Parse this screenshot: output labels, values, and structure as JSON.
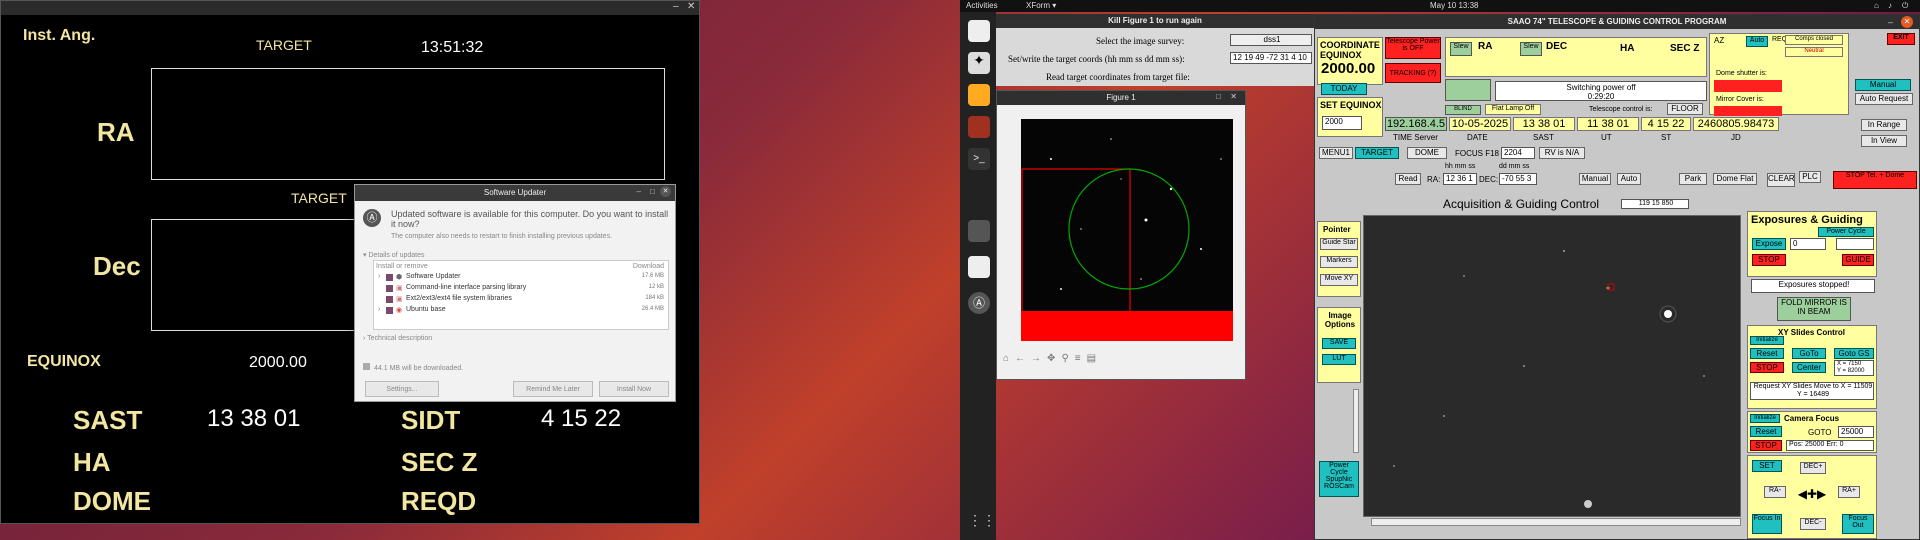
{
  "topbar": {
    "activities": "Activities",
    "app": "XForm ▾",
    "clock": "May 10  13:38"
  },
  "left": {
    "inst_ang": "Inst. Ang.",
    "target1": "TARGET",
    "time": "13:51:32",
    "ra": "RA",
    "target2": "TARGET",
    "dec": "Dec",
    "equinox_label": "EQUINOX",
    "equinox_val": "2000.00",
    "sast_label": "SAST",
    "sast_val": "13 38 01",
    "sidt_label": "SIDT",
    "sidt_val": "4 15 22",
    "ha_label": "HA",
    "secz_label": "SEC Z",
    "dome_label": "DOME",
    "reqd_label": "REQD"
  },
  "updater": {
    "title": "Software Updater",
    "headline": "Updated software is available for this computer. Do you want to install it now?",
    "sub": "The computer also needs to restart to finish installing previous updates.",
    "details": "Details of updates",
    "col_install": "Install or remove",
    "col_download": "Download",
    "items": [
      {
        "name": "Software Updater",
        "size": "17.6 MB"
      },
      {
        "name": "Command-line interface parsing library",
        "size": "12 kB"
      },
      {
        "name": "Ext2/ext3/ext4 file system libraries",
        "size": "184 kB"
      },
      {
        "name": "Ubuntu base",
        "size": "26.4 MB"
      }
    ],
    "tech": "Technical description",
    "total": "44.1 MB will be downloaded.",
    "settings": "Settings...",
    "remind": "Remind Me Later",
    "install": "Install Now"
  },
  "kill": {
    "title": "Kill Figure 1 to run again",
    "q1": "Select the image survey:",
    "v1": "dss1",
    "q2": "Set/write the target coords (hh mm ss dd mm ss):",
    "v2": "12 19 49 -72 31 4 10",
    "q3": "Read target coordinates from target file:"
  },
  "fig1": {
    "title": "Figure 1"
  },
  "saao": {
    "title": "SAAO 74\" TELESCOPE & GUIDING CONTROL PROGRAM",
    "coord_equinox": "COORDINATE EQUINOX",
    "equinox": "2000.00",
    "today": "TODAY",
    "set_equinox": "SET EQUINOX",
    "equinox_input": "2000",
    "tel_power": "Telescope Power is OFF",
    "tracking": "TRACKING (?)",
    "ra_lbl": "RA",
    "dec_lbl": "DEC",
    "ha_lbl": "HA",
    "secz_lbl": "SEC Z",
    "slew": "Slew",
    "status_line1": "Switching power off",
    "status_line2": "0:29:20",
    "blind": "BLIND",
    "flat_lamp": "Flat Lamp Off",
    "tel_control": "Telescope control is:",
    "floor": "FLOOR",
    "ip": "192.168.4.5",
    "date": "10-05-2025",
    "sast": "13 38 01",
    "ut": "11 38 01",
    "st": "4 15 22",
    "jd": "2460805.98473",
    "time_server": "TIME Server",
    "date_lbl": "DATE",
    "sast_lbl": "SAST",
    "ut_lbl": "UT",
    "st_lbl": "ST",
    "jd_lbl": "JD",
    "az": "AZ",
    "auto": "Auto",
    "reqd": "REQD",
    "exit": "EXIT",
    "comps": "Comps closed",
    "neutral": "Neutral",
    "dome_shutter": "Dome shutter is:",
    "mirror_cover": "Mirror Cover is:",
    "manual": "Manual",
    "auto_request": "Auto Request",
    "in_range": "In Range",
    "in_view": "In View",
    "menu1": "MENU1",
    "target": "TARGET",
    "dome": "DOME",
    "focus_lbl": "FOCUS F18",
    "focus_val": "2204",
    "rv": "RV is N/A",
    "hms": "hh  mm  ss",
    "dms": "dd  mm  ss",
    "read": "Read",
    "ra_in": "12 36 1",
    "dec_in": "-70 55 3",
    "park": "Park",
    "dome_flat": "Dome Flat",
    "clear": "CLEAR",
    "plc": "PLC",
    "manual2": "Manual",
    "auto2": "Auto",
    "stop_tel": "STOP Tel. + Dome",
    "acq_title": "Acquisition & Guiding Control",
    "acq_coord": "119 15 850",
    "pointer": "Pointer",
    "guide_star": "Guide Star",
    "markers": "Markers",
    "move_xy": "Move XY",
    "image_options": "Image Options",
    "save": "SAVE",
    "lut": "LUT",
    "power_cycle_spup": "Power Cycle SpupNic ROSCam",
    "exp_title": "Exposures & Guiding",
    "power_cycle": "Power Cycle",
    "expose": "Expose",
    "exp_val": "0",
    "stop": "STOP",
    "guide": "GUIDE",
    "exp_status": "Exposures stopped!",
    "fold_mirror": "FOLD MIRROR IS IN BEAM",
    "xy_title": "XY Slides Control",
    "initialize": "Initialize",
    "reset": "Reset",
    "goto": "GoTo",
    "goto_gs": "Goto GS",
    "center": "Center",
    "xval": "X = 7150",
    "yval": "Y = 82000",
    "xy_req": "Request XY Slides Move to X = 11509   Y = 16489",
    "cam_focus": "Camera Focus",
    "goto_lbl": "GOTO",
    "cam_goto": "25000",
    "cam_pos": "Pos: 25000 Err: 0",
    "set": "SET",
    "decp": "DEC+",
    "ram": "RA-",
    "rap": "RA+",
    "decm": "DEC-",
    "focus_in": "Focus In",
    "focus_out": "Focus Out"
  }
}
